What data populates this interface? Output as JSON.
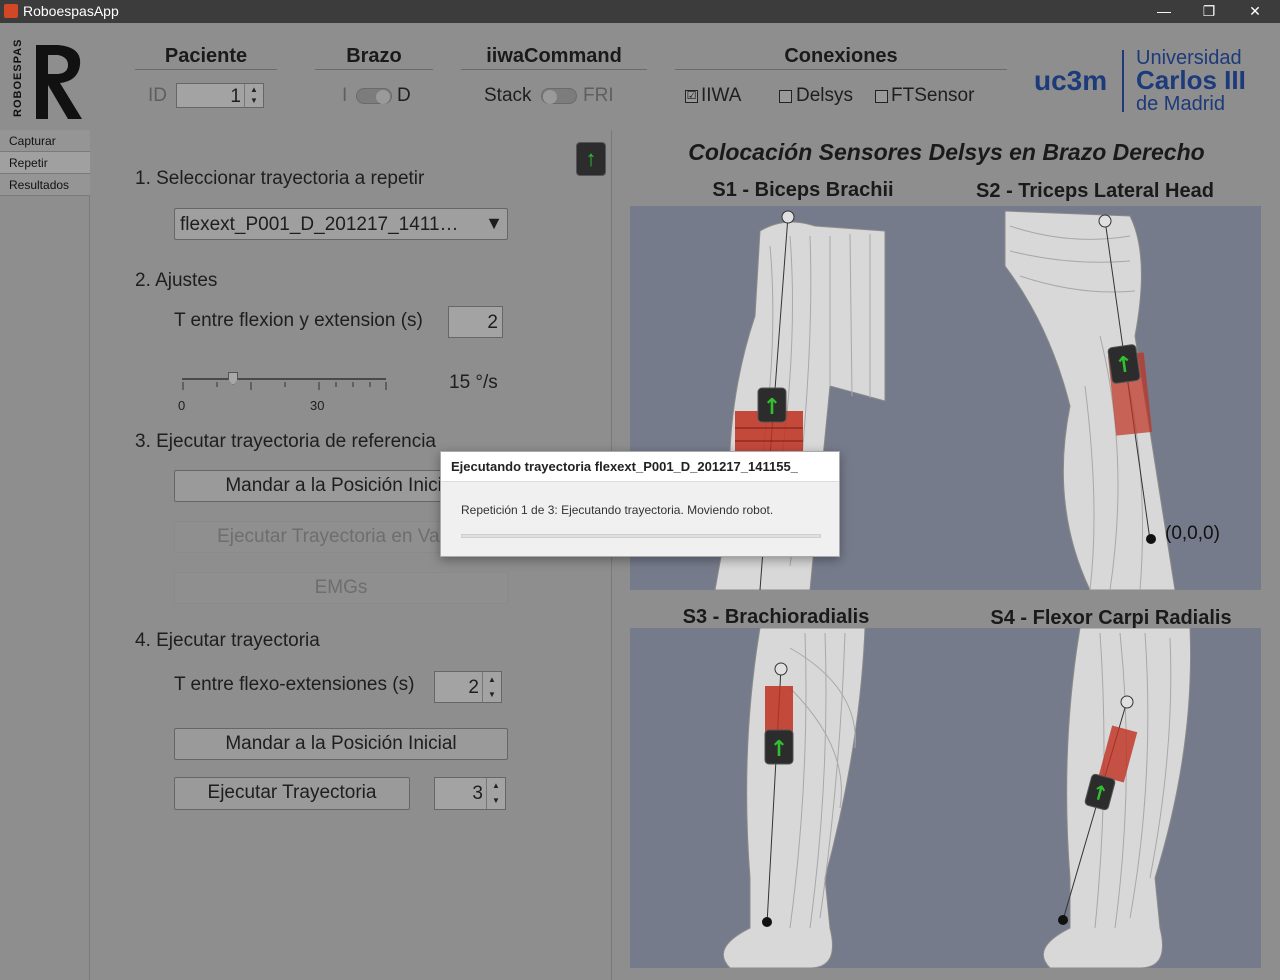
{
  "window": {
    "title": "RoboespasApp",
    "minimize": "—",
    "restore": "❐",
    "close": "✕"
  },
  "header": {
    "logo_text": "ROBOESPAS",
    "paciente": {
      "label": "Paciente",
      "id_label": "ID",
      "id_value": "1"
    },
    "brazo": {
      "label": "Brazo",
      "left": "I",
      "right": "D"
    },
    "iiwa": {
      "label": "iiwaCommand",
      "left": "Stack",
      "right": "FRI"
    },
    "conexiones": {
      "label": "Conexiones",
      "items": [
        {
          "label": "IIWA",
          "checked": "☑"
        },
        {
          "label": "Delsys",
          "checked": ""
        },
        {
          "label": "FTSensor",
          "checked": ""
        }
      ]
    },
    "uni": {
      "short": "uc3m",
      "line1": "Universidad",
      "line2": "Carlos III",
      "line3": "de Madrid"
    }
  },
  "sidebar": {
    "tabs": [
      "Capturar",
      "Repetir",
      "Resultados"
    ]
  },
  "left": {
    "step1": {
      "title": "1. Seleccionar trayectoria a repetir",
      "selected": "flexext_P001_D_201217_1411…"
    },
    "step2": {
      "title": "2. Ajustes",
      "t_label": "T entre flexion y extension (s)",
      "t_value": "2",
      "slider_min": "0",
      "slider_mid": "30",
      "slider_value": 15,
      "speed_label": "15 °/s"
    },
    "step3": {
      "title": "3. Ejecutar trayectoria de referencia",
      "btn_home": "Mandar a la Posición Inicial",
      "btn_run_empty": "Ejecutar Trayectoria en Vacío",
      "btn_emg": "EMGs"
    },
    "step4": {
      "title": "4. Ejecutar trayectoria",
      "t_label": "T entre flexo-extensiones (s)",
      "t_value": "2",
      "btn_home": "Mandar a la Posición Inicial",
      "btn_run": "Ejecutar Trayectoria",
      "reps_value": "3"
    }
  },
  "right": {
    "title": "Colocación Sensores Delsys en Brazo Derecho",
    "s1": "S1 - Biceps Brachii",
    "s2": "S2 - Triceps Lateral Head",
    "s3": "S3 - Brachioradialis",
    "s4": "S4 - Flexor Carpi Radialis",
    "origin": "(0,0,0)"
  },
  "dialog": {
    "title": "Ejecutando trayectoria flexext_P001_D_201217_141155_",
    "message": "Repetición 1 de 3: Ejecutando trayectoria. Moviendo robot.",
    "progress": 0
  }
}
